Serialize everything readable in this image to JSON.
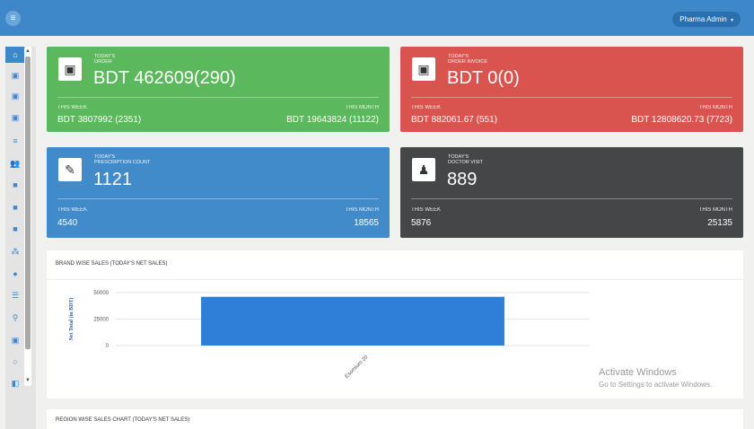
{
  "topbar": {
    "user_menu": "Pharma Admin",
    "caret": "▾",
    "toggle_icon": "≡"
  },
  "sidebar": {
    "items": [
      {
        "icon": "home-icon",
        "glyph": "⌂"
      },
      {
        "icon": "image-icon",
        "glyph": "▣"
      },
      {
        "icon": "image-icon",
        "glyph": "▣"
      },
      {
        "icon": "image-icon",
        "glyph": "▣"
      },
      {
        "icon": "menu-icon",
        "glyph": "≡"
      },
      {
        "icon": "users-icon",
        "glyph": "👥"
      },
      {
        "icon": "briefcase-icon",
        "glyph": "■"
      },
      {
        "icon": "briefcase-icon",
        "glyph": "■"
      },
      {
        "icon": "briefcase-icon",
        "glyph": "■"
      },
      {
        "icon": "sitemap-icon",
        "glyph": "⁂"
      },
      {
        "icon": "user-icon",
        "glyph": "●"
      },
      {
        "icon": "list-icon",
        "glyph": "☰"
      },
      {
        "icon": "map-marker-icon",
        "glyph": "⚲"
      },
      {
        "icon": "image-icon",
        "glyph": "▣"
      },
      {
        "icon": "comment-icon",
        "glyph": "○"
      },
      {
        "icon": "shield-icon",
        "glyph": "◧"
      }
    ]
  },
  "cards": {
    "order": {
      "label1": "TODAY'S",
      "label2": "ORDER",
      "value": "BDT 462609(290)",
      "week_label": "THIS WEEK",
      "week_value": "BDT 3807992 (2351)",
      "month_label": "THIS MONTH",
      "month_value": "BDT 19643824 (11122)",
      "icon_glyph": "▣"
    },
    "invoice": {
      "label1": "TODAY'S",
      "label2": "ORDER INVOICE",
      "value": "BDT 0(0)",
      "week_label": "THIS WEEK",
      "week_value": "BDT 882061.67 (551)",
      "month_label": "THIS MONTH",
      "month_value": "BDT 12808620.73 (7723)",
      "icon_glyph": "▣"
    },
    "prescription": {
      "label1": "TODAY'S",
      "label2": "PRESCRIPTION COUNT",
      "value": "1121",
      "week_label": "THIS WEEK",
      "week_value": "4540",
      "month_label": "THIS MONTH",
      "month_value": "18565",
      "icon_glyph": "✎"
    },
    "doctor": {
      "label1": "TODAY'S",
      "label2": "DOCTOR VISIT",
      "value": "889",
      "week_label": "THIS WEEK",
      "week_value": "5876",
      "month_label": "THIS MONTH",
      "month_value": "25135",
      "icon_glyph": "♟"
    }
  },
  "brand_panel": {
    "title": "BRAND WISE SALES (TODAY'S NET SALES)"
  },
  "region_panel": {
    "title": "REGION WISE SALES CHART (TODAY'S NET SALES)"
  },
  "chart_data": {
    "type": "bar",
    "categories": [
      "Esomium 20"
    ],
    "values": [
      46000
    ],
    "ylabel": "Net Total (in BDT)",
    "ylim": [
      0,
      50000
    ],
    "yticks": [
      "0",
      "25000",
      "50000"
    ],
    "bar_color": "#2f7ed8",
    "grid": true
  },
  "overlay": {
    "line1": "Activate Windows",
    "line2": "Go to Settings to activate Windows."
  }
}
